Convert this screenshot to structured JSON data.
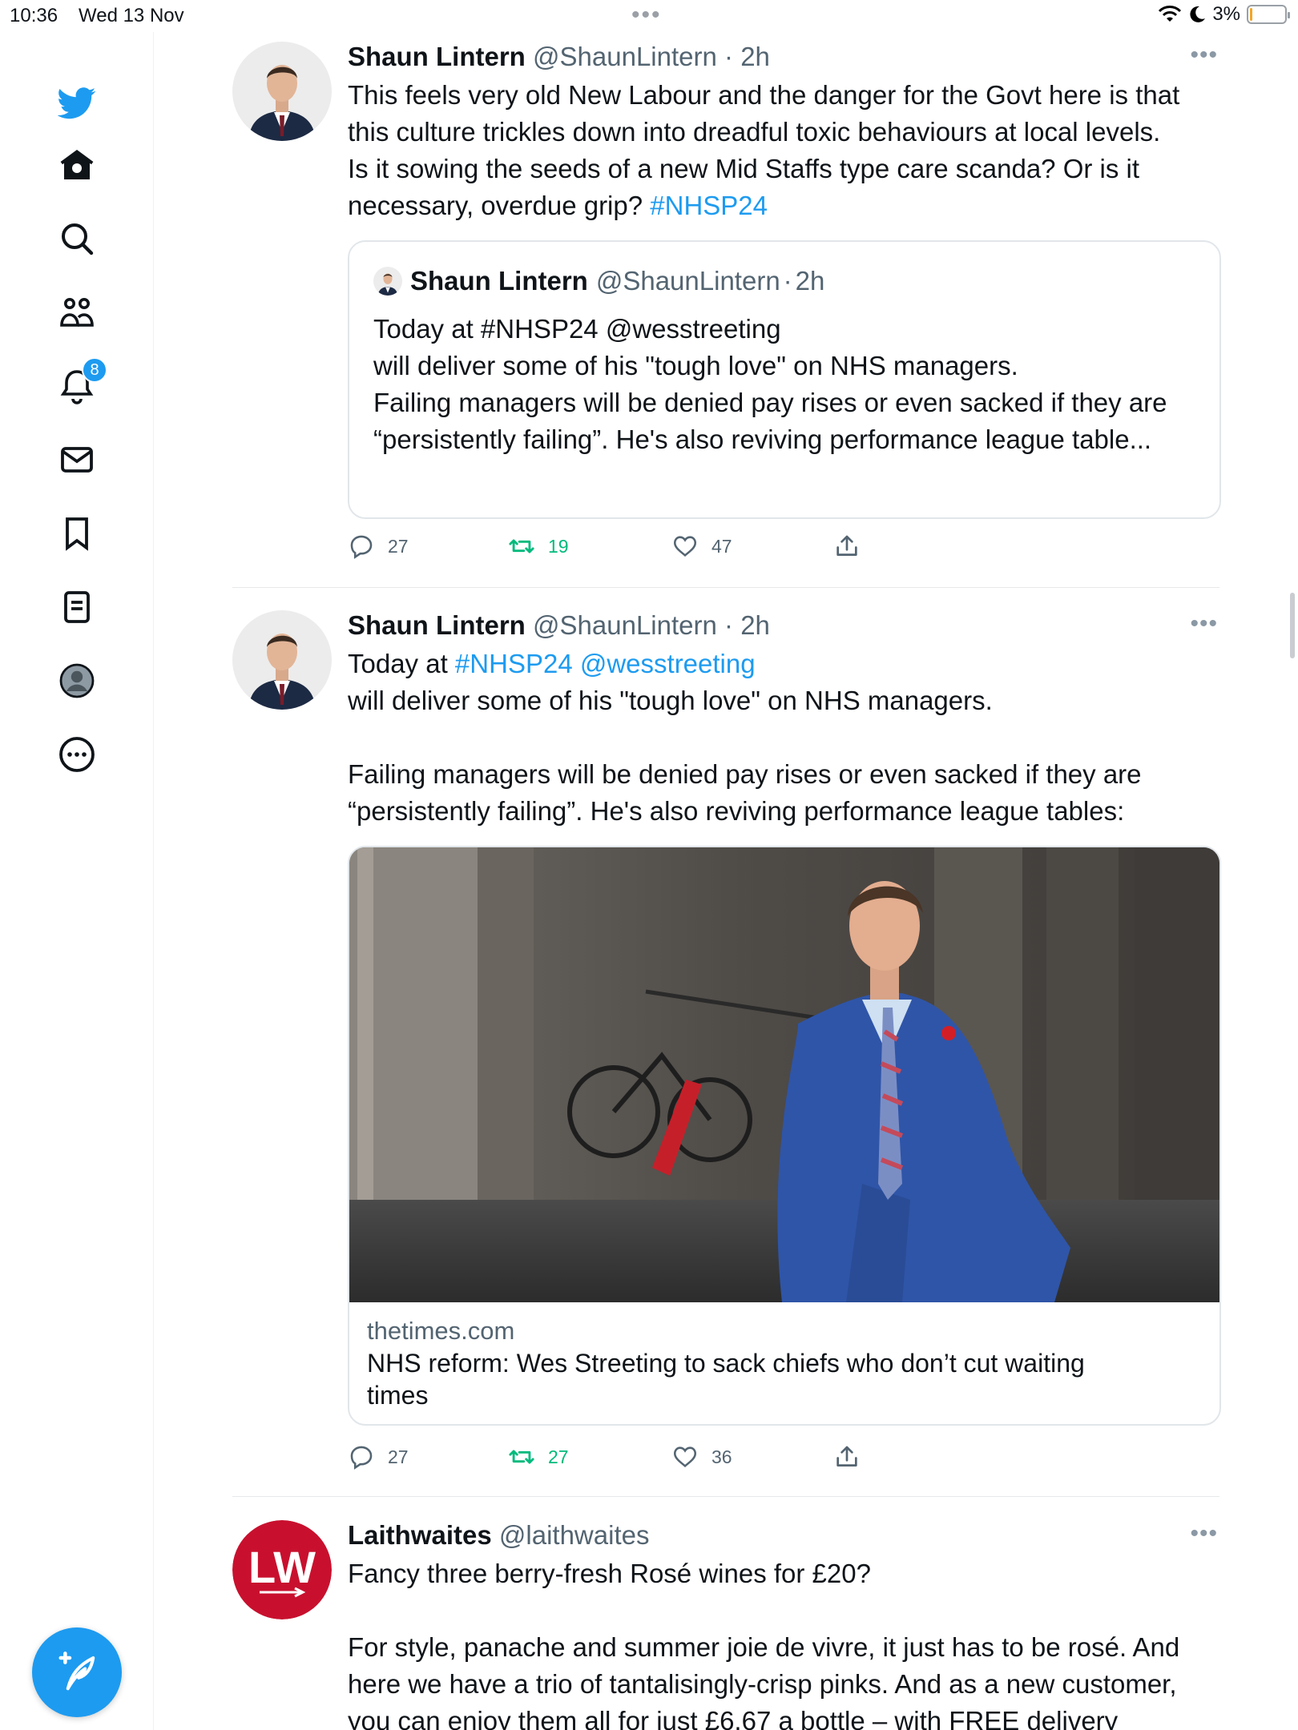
{
  "status": {
    "time": "10:36",
    "date": "Wed 13 Nov",
    "battery": "3%",
    "battery_level": 0.03
  },
  "nav": {
    "notifications_badge": "8",
    "icons": [
      "twitter-logo-icon",
      "home-icon",
      "search-icon",
      "communities-icon",
      "notifications-icon",
      "messages-icon",
      "bookmarks-icon",
      "lists-icon",
      "profile-icon",
      "more-icon"
    ]
  },
  "tweets": [
    {
      "name": "Shaun Lintern",
      "handle": "@ShaunLintern",
      "sep": "·",
      "time": "2h",
      "text_lines": [
        "This feels very old New Labour and the danger for the Govt here is that",
        "this culture trickles down into dreadful toxic behaviours at local levels.",
        "Is it sowing the seeds of a new Mid Staffs type care scanda? Or is it",
        "necessary, overdue grip?"
      ],
      "hashtag": "#NHSP24",
      "quote": {
        "name": "Shaun Lintern",
        "handle": "@ShaunLintern",
        "sep": "·",
        "time": "2h",
        "lines": [
          "Today at #NHSP24 @wesstreeting",
          "will deliver some of his \"tough love\" on NHS managers.",
          "Failing managers will be denied pay rises or even sacked if they are",
          "“persistently failing”. He's also reviving performance league table..."
        ]
      },
      "replies": "27",
      "retweets": "19",
      "likes": "47"
    },
    {
      "name": "Shaun Lintern",
      "handle": "@ShaunLintern",
      "sep": "·",
      "time": "2h",
      "line1_prefix": "Today at",
      "hashtag": "#NHSP24",
      "mention": "@wesstreeting",
      "line2": "will deliver some of his \"tough love\" on NHS managers.",
      "line3": "Failing managers will be denied pay rises or even sacked if they are",
      "line4": "“persistently failing”. He's also reviving performance league tables:",
      "card": {
        "domain": "thetimes.com",
        "title_line1": "NHS reform: Wes Streeting to sack chiefs who don’t cut waiting",
        "title_line2": "times"
      },
      "replies": "27",
      "retweets": "27",
      "likes": "36"
    },
    {
      "name": "Laithwaites",
      "handle": "@laithwaites",
      "avatar_text": "LW",
      "line1": "Fancy three berry-fresh Rosé wines for £20?",
      "line2": "For style, panache and summer joie de vivre, it just has to be rosé. And",
      "line3": "here we have a trio of tantalisingly-crisp pinks. And as a new customer,",
      "line4": "you can enjoy them all for just £6.67 a bottle – with FREE delivery"
    }
  ],
  "colors": {
    "accent": "#1d9bf0",
    "retweet": "#00ba7c",
    "secondary_text": "#536471",
    "laithwaites_red": "#c8102e"
  }
}
